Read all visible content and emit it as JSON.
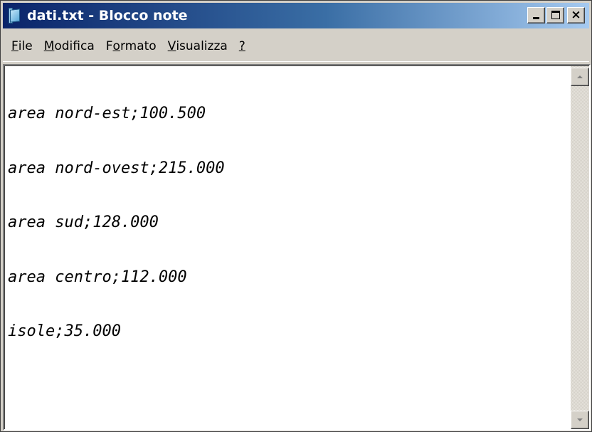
{
  "window": {
    "title": "dati.txt - Blocco note"
  },
  "titlebar_buttons": {
    "minimize_icon": "minimize-icon",
    "maximize_icon": "maximize-icon",
    "close_icon": "close-icon",
    "close_glyph": "×"
  },
  "menu": {
    "items": [
      {
        "first": "F",
        "rest": "ile"
      },
      {
        "first": "M",
        "rest": "odifica"
      },
      {
        "pre": "F",
        "first": "o",
        "rest": "rmato"
      },
      {
        "first": "V",
        "rest": "isualizza"
      },
      {
        "first": "?",
        "rest": ""
      }
    ]
  },
  "document": {
    "lines": [
      "area nord-est;100.500",
      "area nord-ovest;215.000",
      "area sud;128.000",
      "area centro;112.000",
      "isole;35.000"
    ]
  },
  "colors": {
    "titlebar_start": "#0a246a",
    "titlebar_end": "#a6caf0",
    "face": "#d4d0c8",
    "editor_bg": "#ffffff"
  }
}
